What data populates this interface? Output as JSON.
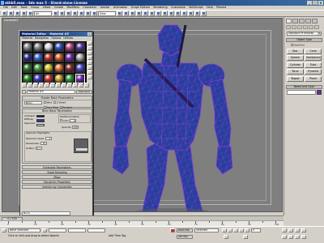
{
  "window": {
    "title": "skhb5.max - 3ds max 5 - Stand-alone License",
    "controls": [
      "_",
      "□",
      "×"
    ]
  },
  "menubar": [
    "File",
    "Edit",
    "Tools",
    "Group",
    "Views",
    "Create",
    "Modifiers",
    "Character",
    "reactor",
    "Animation",
    "Graph Editors",
    "Rendering",
    "Customize",
    "MAXScript",
    "Help",
    "Plasma"
  ],
  "toolbar": {
    "selection_set": "All",
    "view_dropdown": "View"
  },
  "viewport": {
    "label": "Camera01"
  },
  "command_panel": {
    "category_dropdown": "Standard Primitives",
    "rollout_object_type": "Object Type",
    "autogrid_label": "AutoGrid",
    "objects": [
      "Box",
      "Cone",
      "Sphere",
      "GeoSphere",
      "Cylinder",
      "Tube",
      "Torus",
      "Pyramid",
      "Teapot",
      "Plane"
    ],
    "rollout_name_color": "Name and Color"
  },
  "material_editor": {
    "title": "Material Editor - Material #5",
    "menu": [
      "Material",
      "Navigation",
      "Options",
      "Utilities"
    ],
    "material_name": "Material #5",
    "material_type": "Standard",
    "slot_colors": [
      "#8a8a8a",
      "#8a8a8a",
      "#d8d8d8",
      "#2e58c8",
      "#c04a8a",
      "#5a3aa8",
      "#2c2c8a",
      "#3a6ad8",
      "#c03030",
      "#d85a20",
      "#7a2ab8",
      "#a8a8a8",
      "#2a7a2a",
      "#40a040",
      "#c8c020",
      "#e07030",
      "#8a2a2a",
      "#4a4ad0",
      "#1f8a1f",
      "#3a3ac0",
      "#c83030",
      "#c8a020",
      "#2a9a3a",
      "#6a2aa8"
    ],
    "selected_slot": 23,
    "shader_basic": {
      "header": "Shader Basic Parameters",
      "shader": "Blinn",
      "options": [
        "Wire",
        "2-Sided",
        "Face Map",
        "Faceted"
      ]
    },
    "blinn_basic": {
      "header": "Blinn Basic Parameters",
      "self_illum": "Self-Illumination",
      "color_label": "Color",
      "color_value": "0",
      "ambient": "Ambient:",
      "diffuse": "Diffuse:",
      "specular": "Specular:",
      "opacity_label": "Opacity:",
      "opacity_value": "100",
      "spec_header": "Specular Highlights",
      "spec_level_label": "Specular Level:",
      "spec_level_value": "0",
      "gloss_label": "Glossiness:",
      "gloss_value": "10",
      "soften_label": "Soften:",
      "soften_value": "0.1",
      "ambient_color": "#1a1a2a",
      "diffuse_color": "#2a3a8a",
      "specular_color": "#e8e8e8"
    },
    "collapsed_rollouts": [
      "Extended Parameters",
      "SuperSampling",
      "Maps",
      "Dynamics Properties",
      "mental ray Connection"
    ],
    "bottom_dropdown": "None"
  },
  "timeline": {
    "slider": "0 / 100",
    "ticks": [
      "0",
      "10",
      "20",
      "30",
      "40",
      "50",
      "60",
      "70",
      "80",
      "90",
      "100"
    ]
  },
  "statusbar": {
    "selection": "None Selected",
    "prompt": "Click or click-and-drag to select objects",
    "add_time_tag": "Add Time Tag",
    "auto_key": "Auto Key",
    "set_key": "Set Key",
    "key_filter": "Selected",
    "frame": "0"
  },
  "model": {
    "wire_color": "#6a2aa8",
    "fill_color": "#1f3a8a"
  }
}
